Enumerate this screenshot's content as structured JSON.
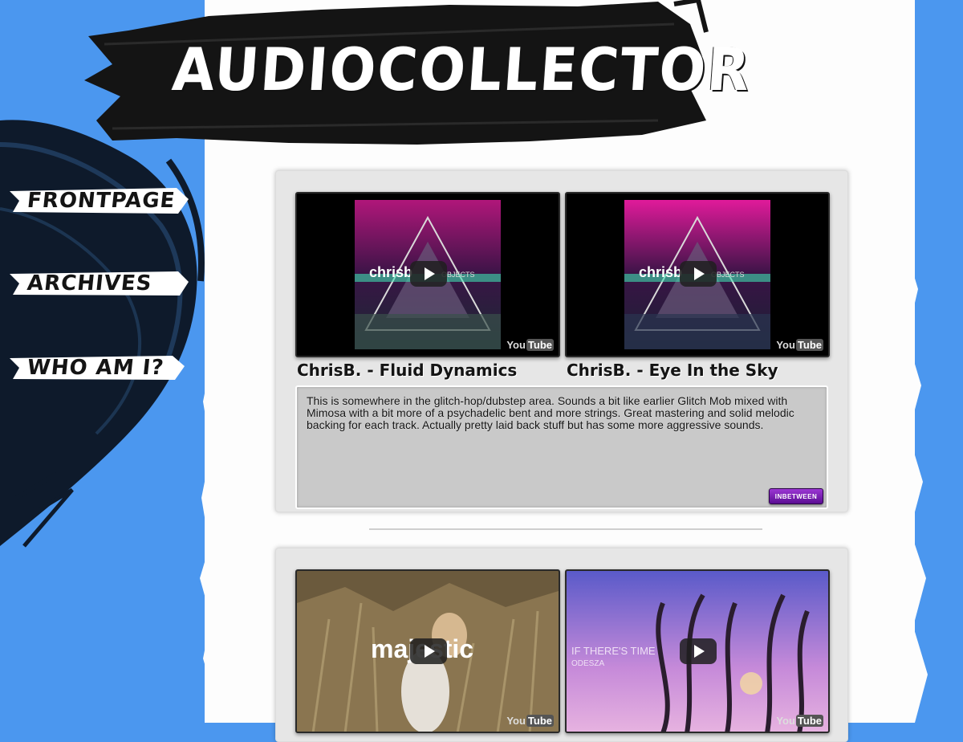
{
  "site": {
    "title": "AUDIOCOLLECTOR"
  },
  "nav": {
    "items": [
      {
        "label": "FRONTPAGE"
      },
      {
        "label": "ARCHIVES"
      },
      {
        "label": "WHO AM I?"
      }
    ]
  },
  "posts": [
    {
      "videos": [
        {
          "title": "ChrisB. - Fluid Dynamics",
          "art_text": "chrisb",
          "art_sub": "OBJECTS",
          "youtube": "You",
          "tube": "Tube"
        },
        {
          "title": "ChrisB. - Eye In the Sky",
          "art_text": "chrisb",
          "art_sub": "OBJECTS",
          "youtube": "You",
          "tube": "Tube"
        }
      ],
      "description": "This is somewhere in the glitch-hop/dubstep area. Sounds a bit like earlier Glitch Mob mixed with Mimosa with a bit more of a psychadelic bent and more strings. Great mastering and solid melodic backing for each track. Actually pretty laid back stuff but has some more aggressive sounds.",
      "tag": "INBETWEEN"
    },
    {
      "videos": [
        {
          "art_text": "majestic",
          "youtube": "You",
          "tube": "Tube"
        },
        {
          "art_text": "IF THERE'S TIME",
          "art_sub": "ODESZA",
          "youtube": "You",
          "tube": "Tube"
        }
      ]
    }
  ],
  "colors": {
    "background": "#4b97ef",
    "paper": "#fdfdfd",
    "brush": "#111111",
    "tag_purple": "#7a1fb5"
  }
}
